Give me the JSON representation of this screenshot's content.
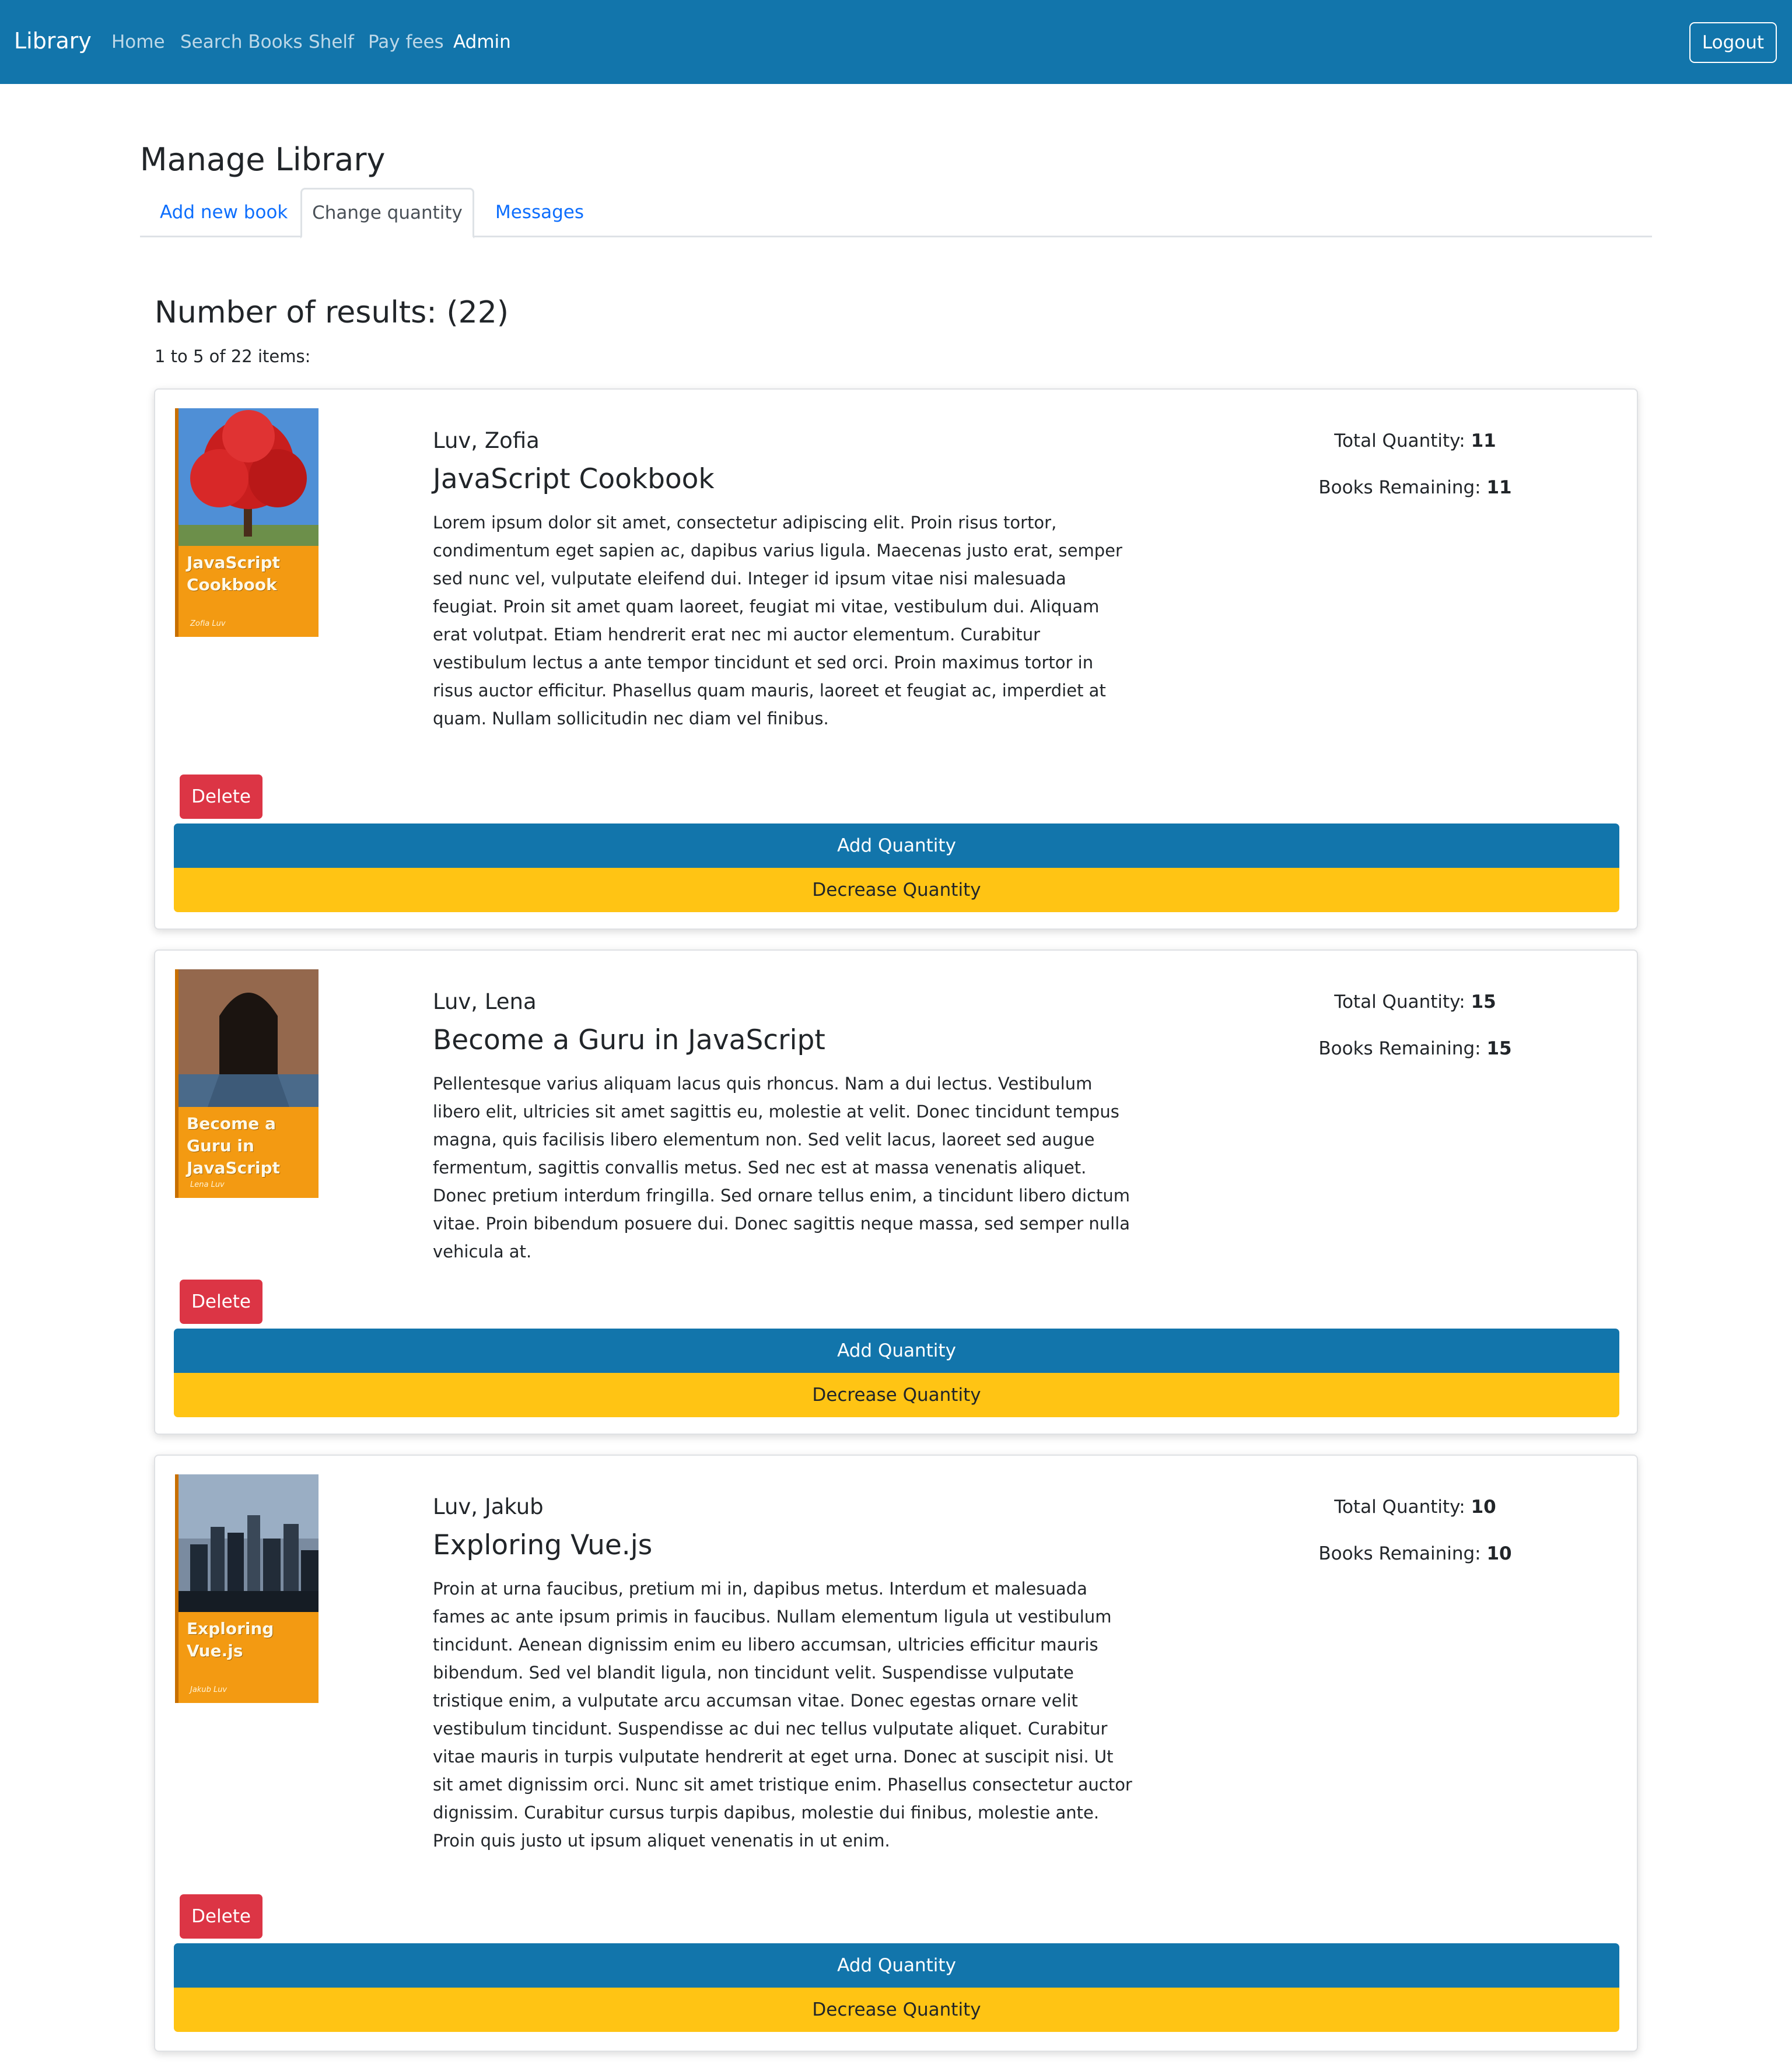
{
  "navbar": {
    "brand": "Library",
    "links": [
      "Home",
      "Search Books",
      "Shelf",
      "Pay fees",
      "Admin"
    ],
    "active_link": "Admin",
    "logout_label": "Logout"
  },
  "page": {
    "title": "Manage Library",
    "tabs": [
      "Add new book",
      "Change quantity",
      "Messages"
    ],
    "active_tab": "Change quantity"
  },
  "results": {
    "heading": "Number of results: (22)",
    "subheading": "1 to 5 of 22 items:"
  },
  "labels": {
    "total_quantity": "Total Quantity:",
    "books_remaining": "Books Remaining:",
    "delete": "Delete",
    "add_quantity": "Add Quantity",
    "decrease_quantity": "Decrease Quantity"
  },
  "books": [
    {
      "author": "Luv, Zofia",
      "title": "JavaScript Cookbook",
      "cover_title": "JavaScript Cookbook",
      "cover_author": "Zofia Luv",
      "description": "Lorem ipsum dolor sit amet, consectetur adipiscing elit. Proin risus tortor, condimentum eget sapien ac, dapibus varius ligula. Maecenas justo erat, semper sed nunc vel, vulputate eleifend dui. Integer id ipsum vitae nisi malesuada feugiat. Proin sit amet quam laoreet, feugiat mi vitae, vestibulum dui. Aliquam erat volutpat. Etiam hendrerit erat nec mi auctor elementum. Curabitur vestibulum lectus a ante tempor tincidunt et sed orci. Proin maximus tortor in risus auctor efficitur. Phasellus quam mauris, laoreet et feugiat ac, imperdiet at quam. Nullam sollicitudin nec diam vel finibus.",
      "total_quantity": "11",
      "books_remaining": "11"
    },
    {
      "author": "Luv, Lena",
      "title": "Become a Guru in JavaScript",
      "cover_title": "Become a Guru in JavaScript",
      "cover_author": "Lena Luv",
      "description": "Pellentesque varius aliquam lacus quis rhoncus. Nam a dui lectus. Vestibulum libero elit, ultricies sit amet sagittis eu, molestie at velit. Donec tincidunt tempus magna, quis facilisis libero elementum non. Sed velit lacus, laoreet sed augue fermentum, sagittis convallis metus. Sed nec est at massa venenatis aliquet. Donec pretium interdum fringilla. Sed ornare tellus enim, a tincidunt libero dictum vitae. Proin bibendum posuere dui. Donec sagittis neque massa, sed semper nulla vehicula at.",
      "total_quantity": "15",
      "books_remaining": "15"
    },
    {
      "author": "Luv, Jakub",
      "title": "Exploring Vue.js",
      "cover_title": "Exploring Vue.js",
      "cover_author": "Jakub Luv",
      "description": "Proin at urna faucibus, pretium mi in, dapibus metus. Interdum et malesuada fames ac ante ipsum primis in faucibus. Nullam elementum ligula ut vestibulum tincidunt. Aenean dignissim enim eu libero accumsan, ultricies efficitur mauris bibendum. Sed vel blandit ligula, non tincidunt velit. Suspendisse vulputate tristique enim, a vulputate arcu accumsan vitae. Donec egestas ornare velit vestibulum tincidunt. Suspendisse ac dui nec tellus vulputate aliquet. Curabitur vitae mauris in turpis vulputate hendrerit at eget urna. Donec at suscipit nisi. Ut sit amet dignissim orci. Nunc sit amet tristique enim. Phasellus consectetur auctor dignissim. Curabitur cursus turpis dapibus, molestie dui finibus, molestie ante. Proin quis justo ut ipsum aliquet venenatis in ut enim.",
      "total_quantity": "10",
      "books_remaining": "10"
    }
  ]
}
